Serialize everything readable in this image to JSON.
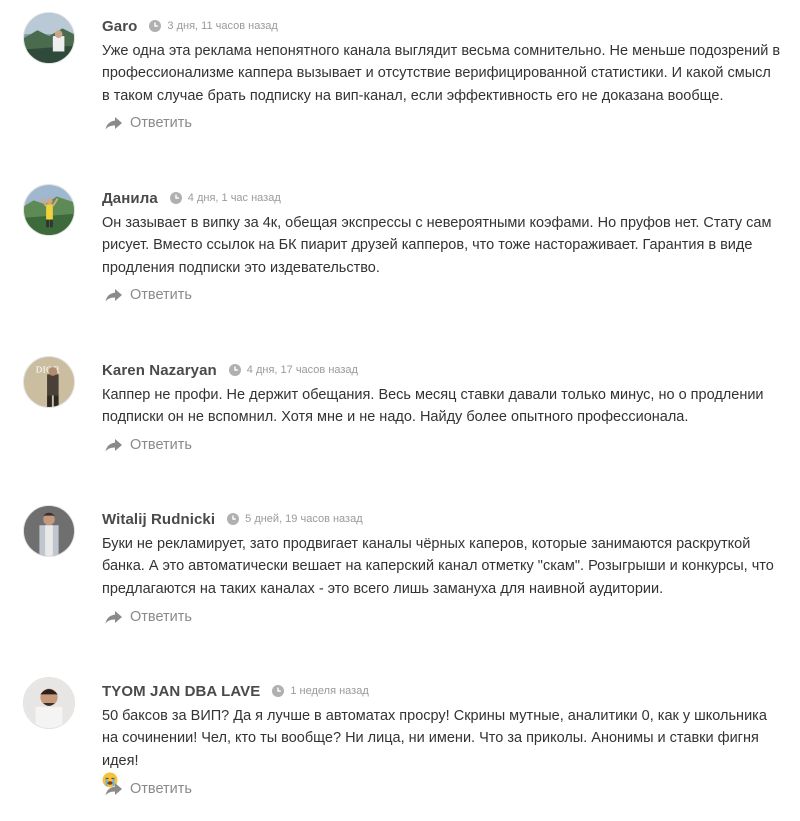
{
  "comments": [
    {
      "author": "Garo",
      "date": "3 дня, 11 часов назад",
      "text": "Уже одна эта реклама непонятного канала выглядит весьма сомнительно. Не меньше подозрений в профессионализме каппера вызывает и отсутствие верифицированной статистики. И какой смысл в таком случае брать подписку на вип-канал, если эффективность его не доказана вообще.",
      "reply_label": "Ответить"
    },
    {
      "author": "Данила",
      "date": "4 дня, 1 час назад",
      "text": "Он зазывает в випку за 4к, обещая экспрессы с невероятными коэфами. Но пруфов нет. Стату сам рисует. Вместо ссылок на БК пиарит друзей капперов, что тоже настораживает. Гарантия в виде продления подписки это издевательство.",
      "reply_label": "Ответить"
    },
    {
      "author": "Karen Nazaryan",
      "date": "4 дня, 17 часов назад",
      "avatar_text": "DIOR",
      "text": "Каппер не профи. Не держит обещания. Весь месяц ставки давали только минус, но о продлении подписки он не вспомнил. Хотя мне и не надо. Найду более опытного профессионала.",
      "reply_label": "Ответить"
    },
    {
      "author": "Witalij Rudnicki",
      "date": "5 дней, 19 часов назад",
      "text": "Буки не рекламирует, зато продвигает каналы чёрных каперов, которые занимаются раскруткой банка. А это автоматически вешает на каперский канал отметку \"скам\". Розыгрыши и конкурсы, что предлагаются на таких каналах - это всего лишь замануха для наивной аудитории.",
      "reply_label": "Ответить"
    },
    {
      "author": "TYOM JAN DBA LAVE",
      "date": "1 неделя назад",
      "text": "50 баксов за ВИП? Да я лучше в автоматах просру! Скрины мутные, аналитики 0, как у школьника на сочинении! Чел, кто ты вообще? Ни лица, ни имени. Что за приколы. Анонимы и ставки фигня идея!",
      "reply_label": "Ответить"
    }
  ],
  "icons": {
    "clock": "clock-icon",
    "reply": "reply-arrow-icon",
    "emoji": "crying-face-emoji"
  },
  "colors": {
    "author": "#4a4a4a",
    "text": "#333333",
    "meta": "#9a9a9a",
    "reply": "#8a8a8a"
  }
}
